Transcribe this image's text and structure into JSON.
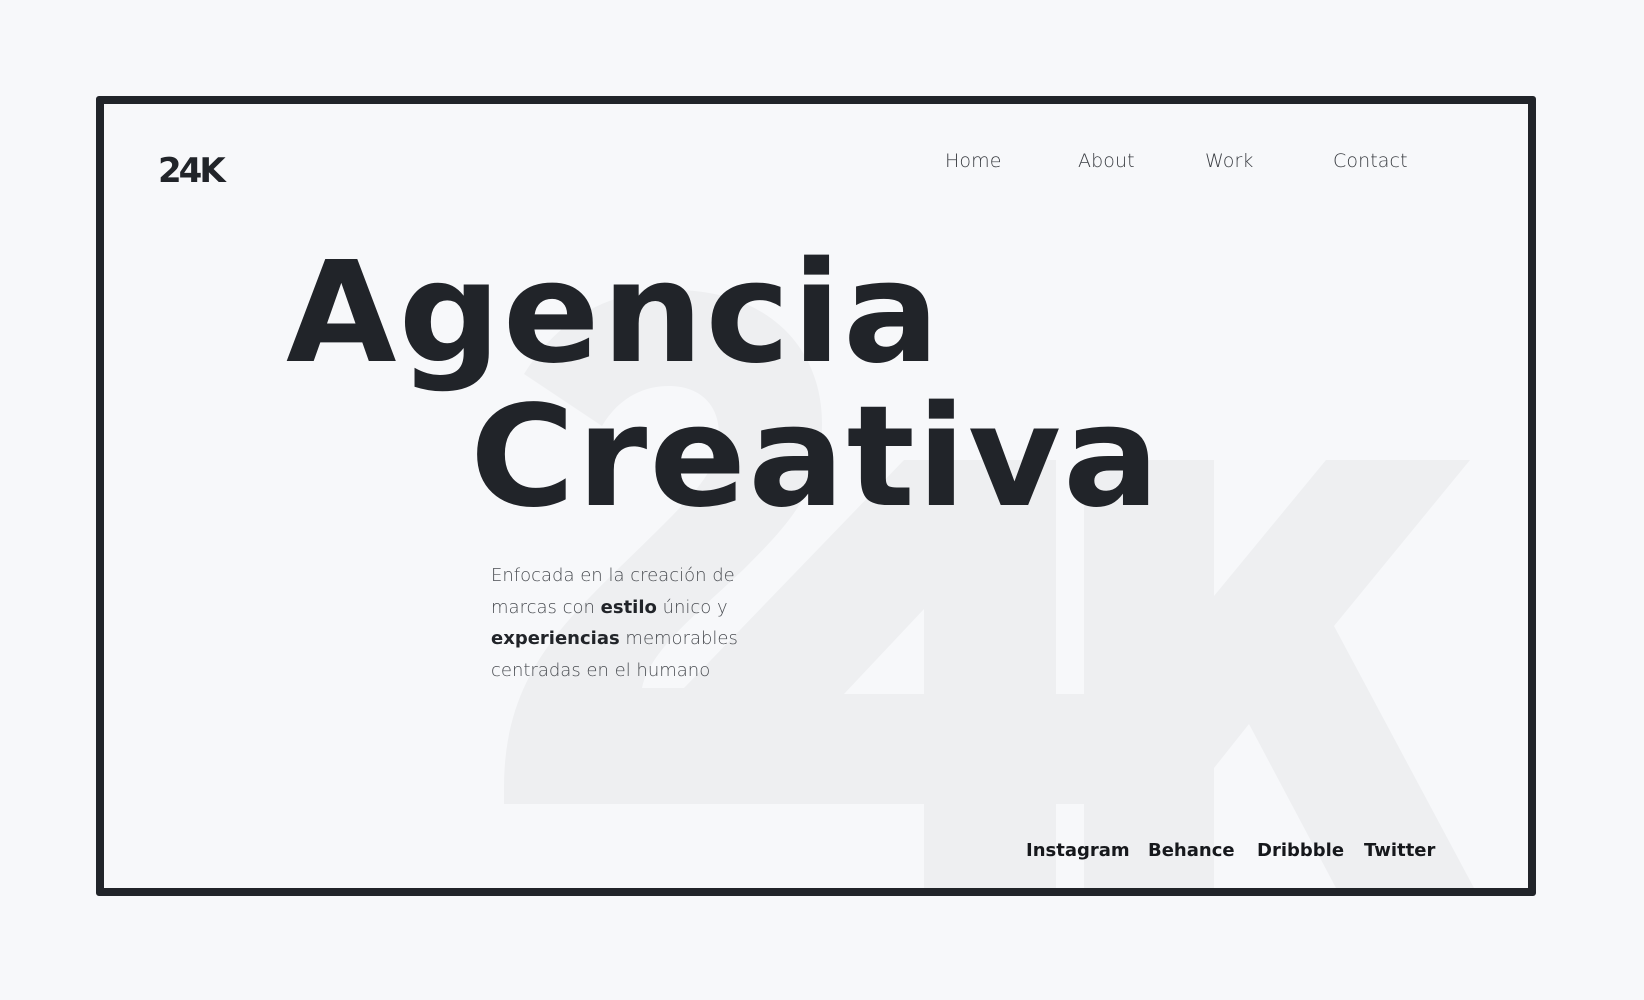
{
  "brand": {
    "logo_text": "24K",
    "watermark_text": "24K"
  },
  "nav": {
    "items": [
      {
        "label": "Home"
      },
      {
        "label": "About"
      },
      {
        "label": "Work"
      },
      {
        "label": "Contact"
      }
    ]
  },
  "hero": {
    "line1": "Agencia",
    "line2": "Creativa"
  },
  "description": {
    "line1": "Enfocada en la creación de",
    "line2_pre": "marcas con ",
    "line2_bold": "estilo",
    "line2_post": " único y",
    "line3_bold": "experiencias",
    "line3_post": " memorables",
    "line4": "centradas en el humano"
  },
  "social": {
    "items": [
      {
        "label": "Instagram"
      },
      {
        "label": "Behance"
      },
      {
        "label": "Dribbble"
      },
      {
        "label": "Twitter"
      }
    ]
  },
  "colors": {
    "ink": "#212429",
    "background": "#f7f8fa",
    "watermark": "#eeeff1"
  }
}
